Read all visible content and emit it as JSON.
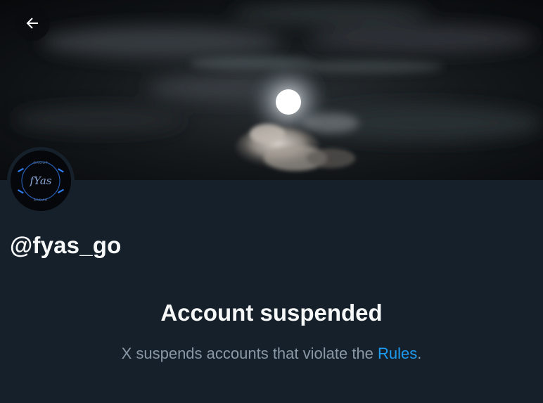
{
  "profile": {
    "handle": "@fyas_go",
    "avatar_text": "fYas"
  },
  "header": {
    "back_icon": "arrow-left-icon"
  },
  "suspension": {
    "title": "Account suspended",
    "message_before": "X suspends accounts that violate the ",
    "rules_link": "Rules",
    "message_after": "."
  },
  "colors": {
    "background": "#15202b",
    "text_primary": "#f7f9f9",
    "text_secondary": "#8b98a5",
    "link": "#1d9bf0"
  }
}
